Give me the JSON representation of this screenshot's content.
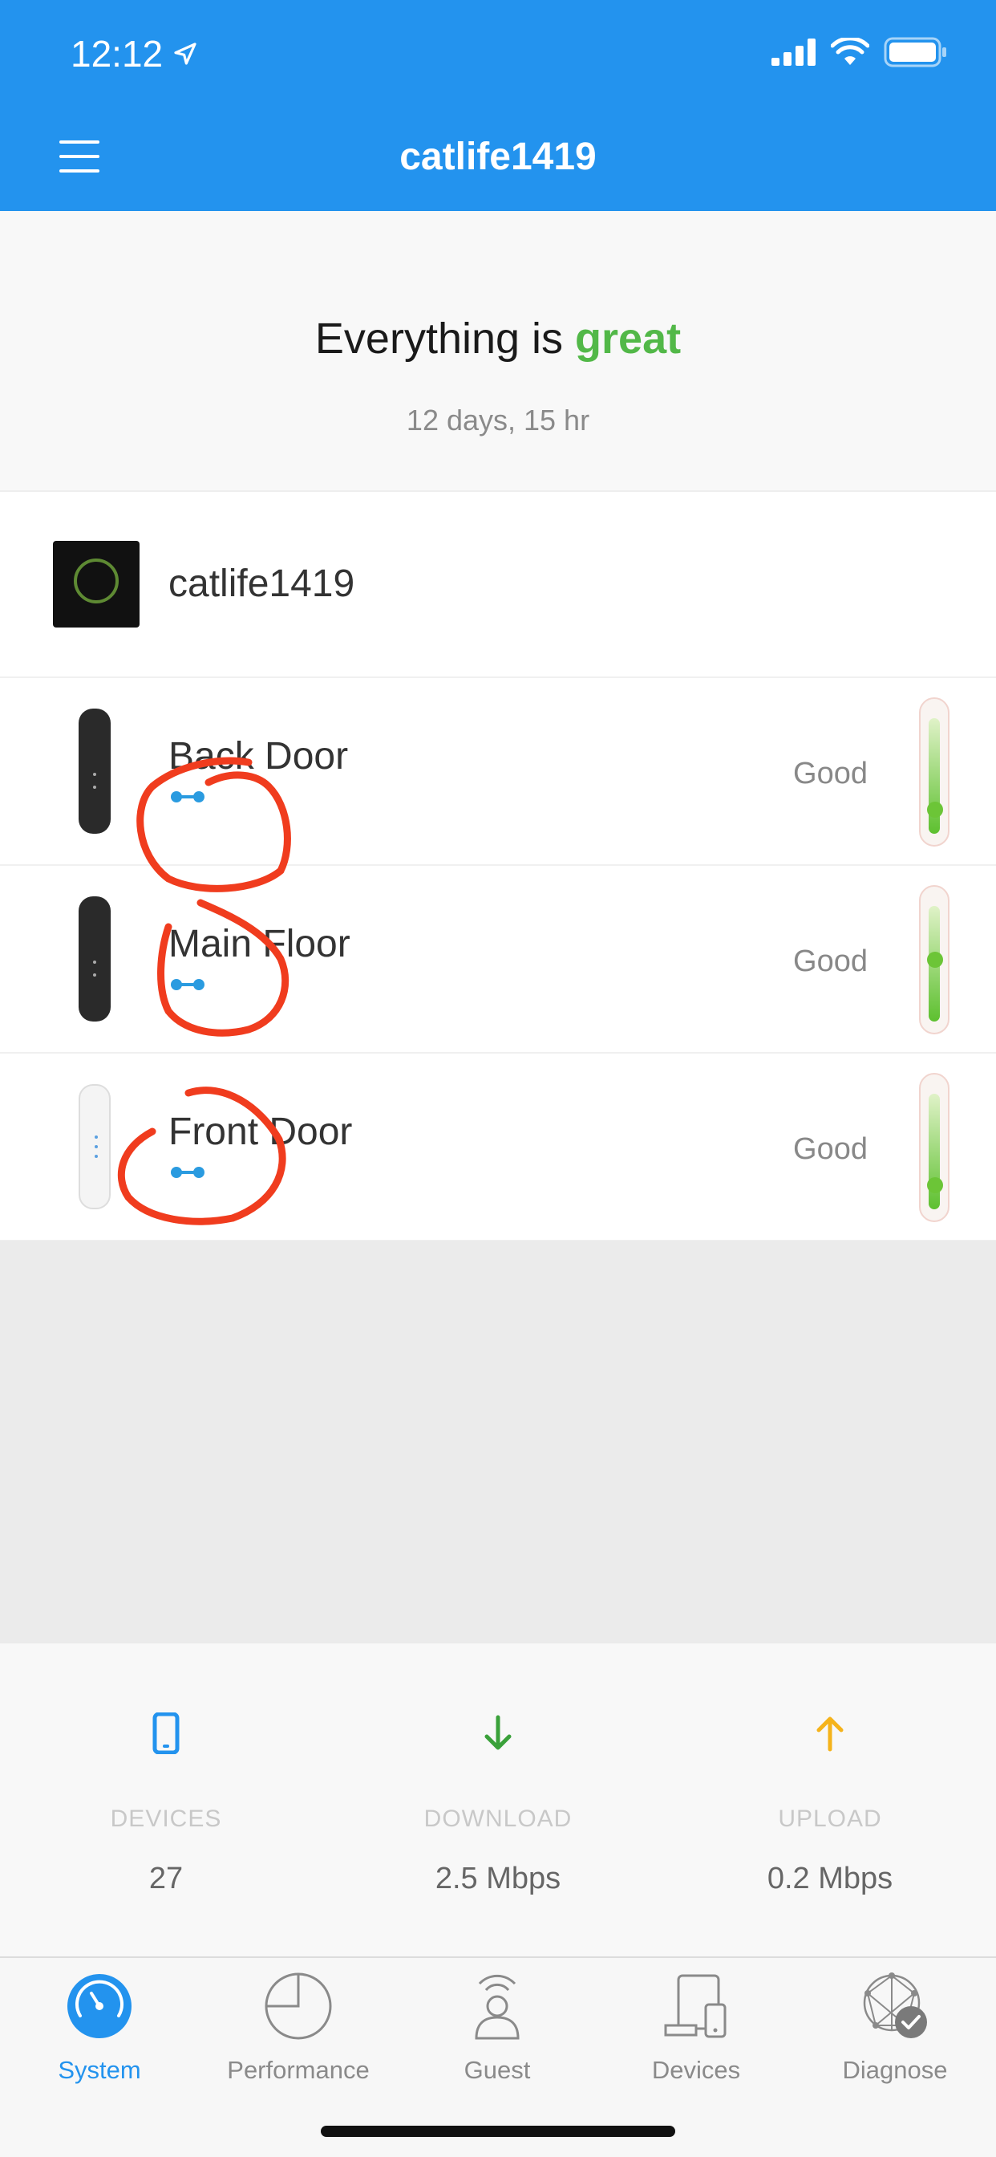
{
  "status_bar": {
    "time": "12:12"
  },
  "header": {
    "title": "catlife1419"
  },
  "summary": {
    "prefix": "Everything is ",
    "state": "great",
    "uptime": "12 days, 15 hr"
  },
  "router": {
    "name": "catlife1419"
  },
  "nodes": [
    {
      "name": "Back Door",
      "status": "Good",
      "signal_level": 0.15
    },
    {
      "name": "Main Floor",
      "status": "Good",
      "signal_level": 0.5
    },
    {
      "name": "Front Door",
      "status": "Good",
      "signal_level": 0.15
    }
  ],
  "stats": [
    {
      "label": "DEVICES",
      "value": "27",
      "icon": "phone-icon",
      "color": "#2393ee"
    },
    {
      "label": "DOWNLOAD",
      "value": "2.5 Mbps",
      "icon": "arrow-down-icon",
      "color": "#3aa13a"
    },
    {
      "label": "UPLOAD",
      "value": "0.2 Mbps",
      "icon": "arrow-up-icon",
      "color": "#f5b31b"
    }
  ],
  "tabs": [
    {
      "label": "System",
      "active": true
    },
    {
      "label": "Performance",
      "active": false
    },
    {
      "label": "Guest",
      "active": false
    },
    {
      "label": "Devices",
      "active": false
    },
    {
      "label": "Diagnose",
      "active": false
    }
  ],
  "colors": {
    "header": "#2393ee",
    "great": "#52b848",
    "annotation": "#f03c1e",
    "mesh": "#2a9be0"
  }
}
